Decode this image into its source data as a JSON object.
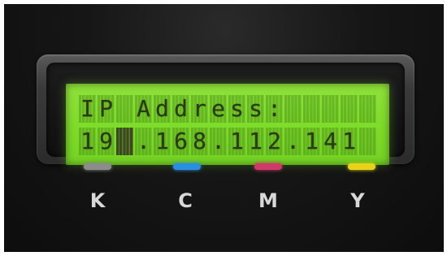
{
  "display": {
    "line1": [
      "I",
      "P",
      " ",
      "A",
      "d",
      "d",
      "r",
      "e",
      "s",
      "s",
      ":",
      " ",
      " ",
      " ",
      " ",
      " "
    ],
    "line2": [
      "1",
      "9",
      "",
      ".",
      "1",
      "6",
      "8",
      ".",
      "1",
      "1",
      "2",
      ".",
      "1",
      "4",
      "1",
      " "
    ],
    "cursor_index": 2,
    "lcd_color": "#7fdc2a"
  },
  "toner_indicators": [
    {
      "label": "K",
      "color": "#8c8c8c",
      "icon": "led-gray"
    },
    {
      "label": "C",
      "color": "#2a8fe0",
      "icon": "led-cyan"
    },
    {
      "label": "M",
      "color": "#d03a6a",
      "icon": "led-magenta"
    },
    {
      "label": "Y",
      "color": "#e8d21a",
      "icon": "led-yellow"
    }
  ]
}
